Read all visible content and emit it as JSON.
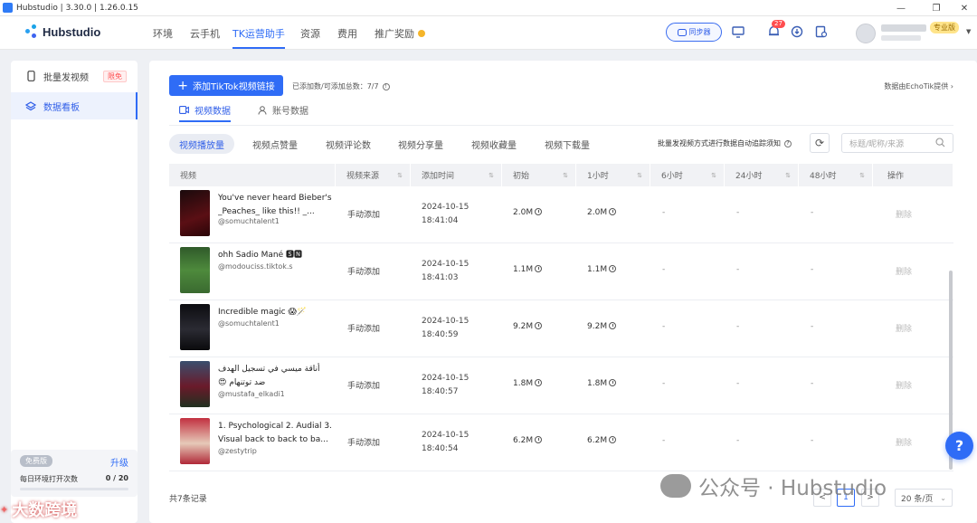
{
  "window": {
    "title": "Hubstudio | 3.30.0 | 1.26.0.15",
    "controls": [
      "—",
      "❐",
      "✕"
    ]
  },
  "brand": {
    "name": "Hubstudio",
    "accent": "#2f6cf6"
  },
  "nav": {
    "tabs": [
      "环境",
      "云手机",
      "TK运营助手",
      "资源",
      "费用",
      "推广奖励"
    ],
    "active": "TK运营助手"
  },
  "topbar": {
    "sync_label": "同步器",
    "notification_count": "27",
    "vip_label": "专业版"
  },
  "sidebar": {
    "items": [
      {
        "label": "批量发视频",
        "tag": "限免",
        "icon": "phone-icon"
      },
      {
        "label": "数据看板",
        "icon": "layers-icon"
      }
    ],
    "active": "数据看板",
    "plan": {
      "badge": "免费版",
      "upgrade": "升级",
      "label": "每日环境打开次数",
      "count": "0 / 20",
      "usage_fraction": 0
    }
  },
  "main": {
    "add_button": "添加TikTok视频链接",
    "added_info": "已添加数/可添加总数：7/7",
    "provider": "数据由EchoTik提供",
    "subtabs": [
      "视频数据",
      "账号数据"
    ],
    "active_subtab": "视频数据",
    "metric_tabs": [
      "视频播放量",
      "视频点赞量",
      "视频评论数",
      "视频分享量",
      "视频收藏量",
      "视频下载量"
    ],
    "active_metric": "视频播放量",
    "notice": "批量发视频方式进行数据自动追踪须知",
    "search_placeholder": "标题/昵称/来源",
    "columns": [
      "视频",
      "视频来源",
      "添加时间",
      "初始",
      "1小时",
      "6小时",
      "24小时",
      "48小时",
      "操作"
    ],
    "rows": [
      {
        "title": "You've never heard Bieber's _Peaches_ like this!! _...",
        "author": "@somuchtalent1",
        "source": "手动添加",
        "date": "2024-10-15",
        "time": "18:41:04",
        "initial": "2.0M",
        "h1": "2.0M",
        "h6": "-",
        "h24": "-",
        "h48": "-",
        "action": "删除"
      },
      {
        "title": "ohh Sadio Mané 🆂🅽",
        "author": "@modouciss.tiktok.s",
        "source": "手动添加",
        "date": "2024-10-15",
        "time": "18:41:03",
        "initial": "1.1M",
        "h1": "1.1M",
        "h6": "-",
        "h24": "-",
        "h48": "-",
        "action": "删除"
      },
      {
        "title": "Incredible magic 😱🪄",
        "author": "@somuchtalent1",
        "source": "手动添加",
        "date": "2024-10-15",
        "time": "18:40:59",
        "initial": "9.2M",
        "h1": "9.2M",
        "h6": "-",
        "h24": "-",
        "h48": "-",
        "action": "删除"
      },
      {
        "title": "أناقة ميسي في تسجيل الهدف ضد توتنهام 😍",
        "author": "@mustafa_elkadi1",
        "source": "手动添加",
        "date": "2024-10-15",
        "time": "18:40:57",
        "initial": "1.8M",
        "h1": "1.8M",
        "h6": "-",
        "h24": "-",
        "h48": "-",
        "action": "删除"
      },
      {
        "title": "1. Psychological 2. Audial 3. Visual back to back to ba...",
        "author": "@zestytrip",
        "source": "手动添加",
        "date": "2024-10-15",
        "time": "18:40:54",
        "initial": "6.2M",
        "h1": "6.2M",
        "h6": "-",
        "h24": "-",
        "h48": "-",
        "action": "删除"
      }
    ],
    "total": "共7条记录",
    "pagination": {
      "prev": "<",
      "page": "1",
      "next": ">",
      "page_size": "20 条/页"
    }
  },
  "watermark": {
    "text": "公众号 · Hubstudio",
    "corner": "大数跨境"
  },
  "help_label": "?"
}
